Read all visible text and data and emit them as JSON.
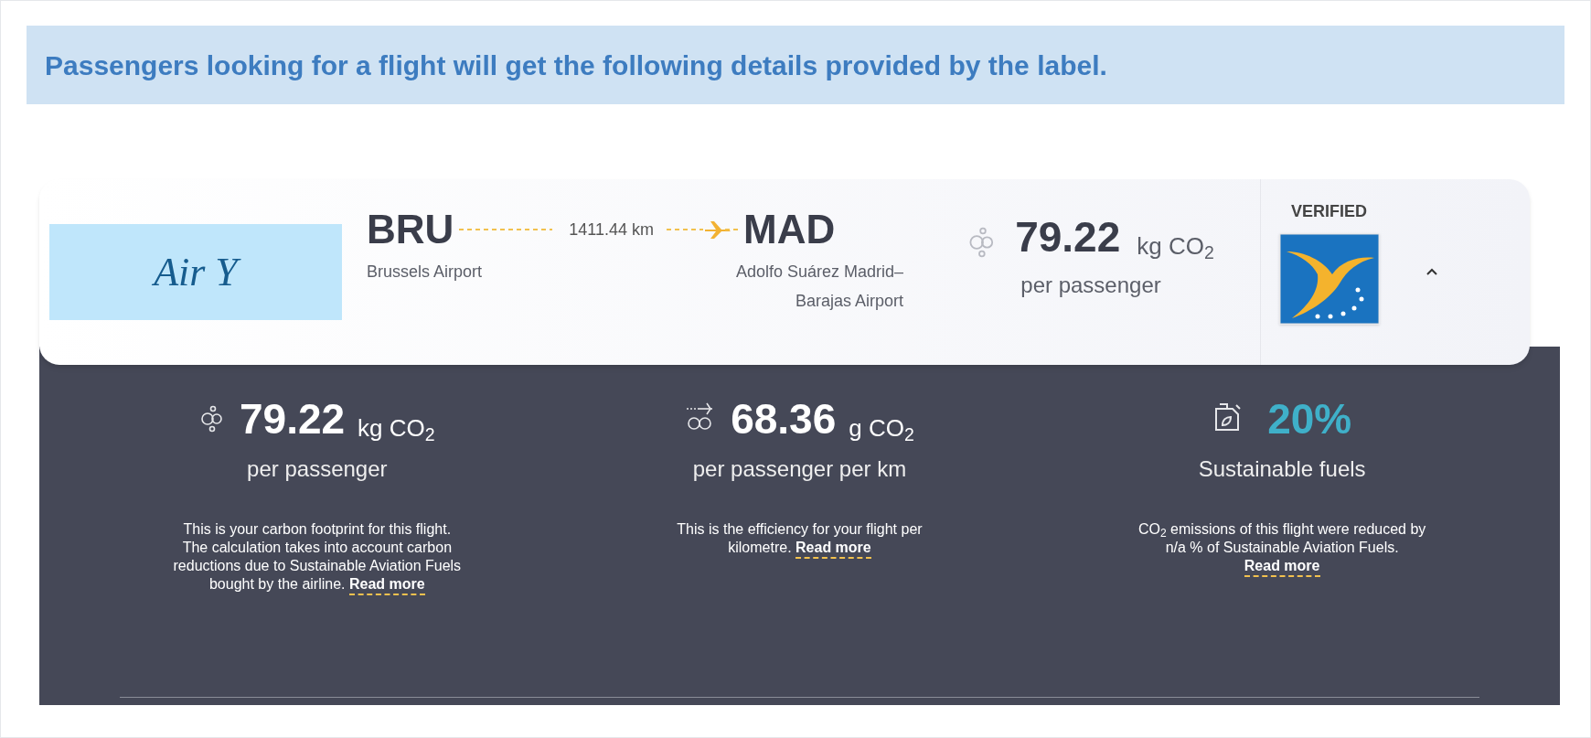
{
  "banner": {
    "text": "Passengers looking for a flight will get the following details provided by the label."
  },
  "flight": {
    "airline_logo": "Air Y",
    "origin": {
      "code": "BRU",
      "name": "Brussels Airport"
    },
    "distance": "1411.44 km",
    "destination": {
      "code": "MAD",
      "name": "Adolfo Suárez Madrid–Barajas Airport"
    },
    "emissions": {
      "value": "79.22",
      "unit": "kg CO$_{2}$",
      "caption": "per passenger"
    },
    "verified": "VERIFIED",
    "expanded": true
  },
  "details": [
    {
      "kind": "co2",
      "value": "79.22",
      "unit": "kg CO$_{2}$",
      "caption": "per passenger",
      "description": "This is your carbon footprint for this flight. The calculation takes into account carbon reductions due to Sustainable Aviation Fuels bought by the airline.",
      "link": "Read more"
    },
    {
      "kind": "efficiency",
      "value": "68.36",
      "unit": "g CO$_{2}$",
      "caption": "per passenger per km",
      "description": "This is the efficiency for your flight per kilometre.",
      "link": "Read more"
    },
    {
      "kind": "fuel",
      "value": "20%",
      "caption": "Sustainable fuels",
      "description": "CO$_{2}$ emissions of this flight were reduced by n/a % of Sustainable Aviation Fuels.",
      "link": "Read more"
    }
  ]
}
